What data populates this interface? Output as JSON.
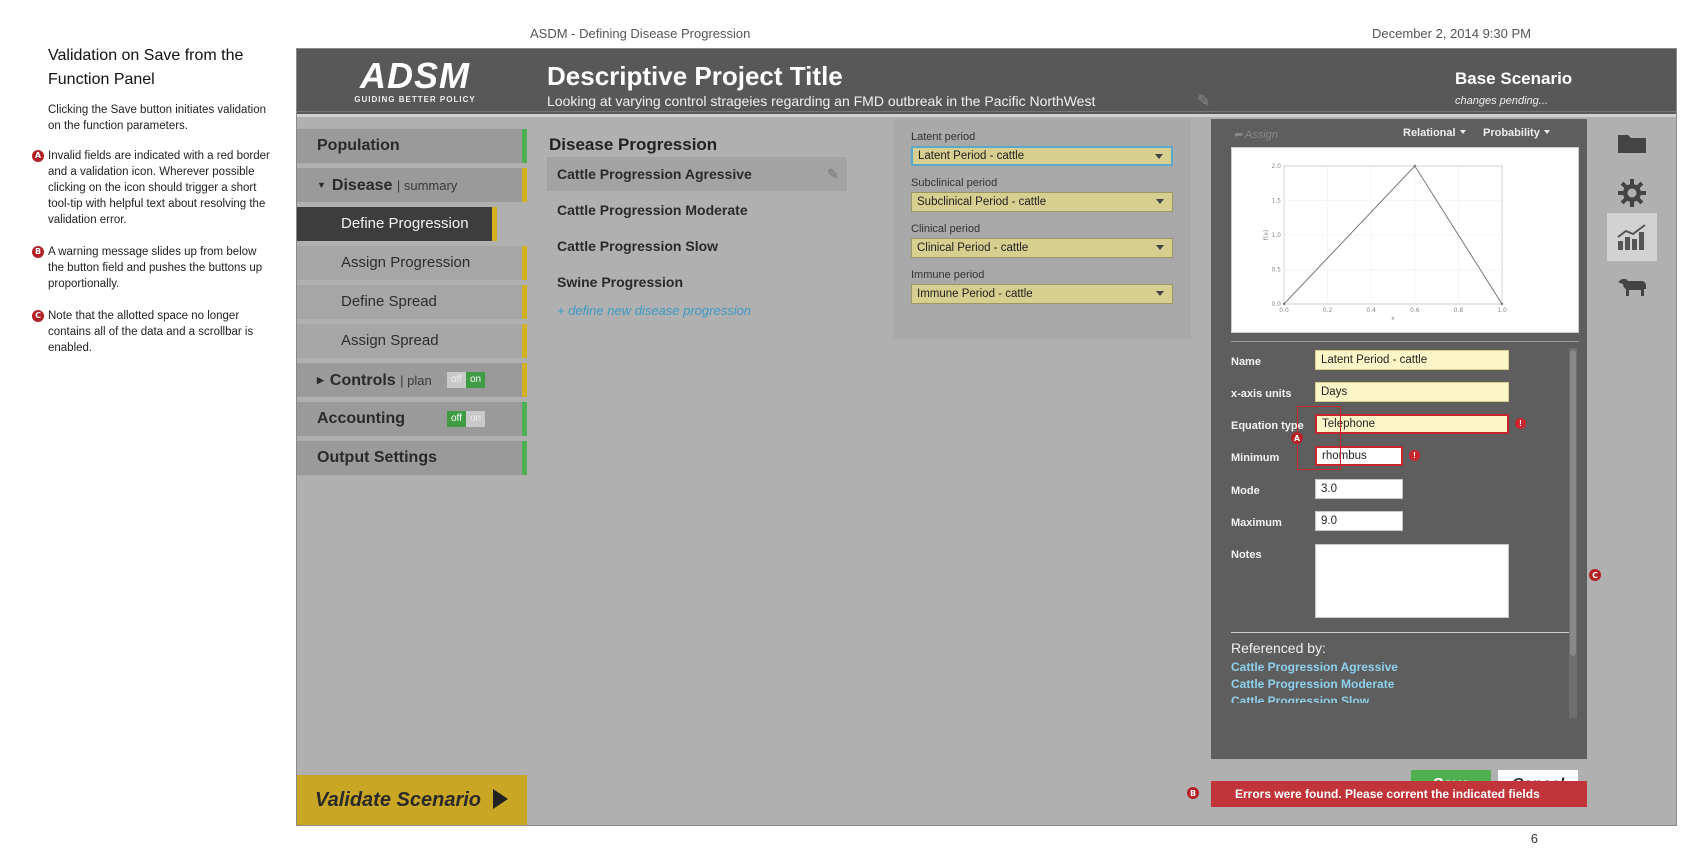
{
  "document": {
    "title": "ASDM - Defining Disease Progression",
    "date": "December 2, 2014  9:30 PM",
    "page_number": "6"
  },
  "annotations": {
    "heading": "Validation on Save from the Function Panel",
    "intro": "Clicking the Save button initiates validation on the function parameters.",
    "items": [
      {
        "badge": "A",
        "text": "Invalid fields are indicated with a red border and a validation icon. Wherever possible clicking on the icon should trigger a short tool-tip with helpful text about resolving the validation error."
      },
      {
        "badge": "B",
        "text": "A warning message slides up from below the button field and pushes the buttons up proportionally."
      },
      {
        "badge": "C",
        "text": "Note that the allotted space no longer contains all of the data and a scrollbar is enabled."
      }
    ]
  },
  "header": {
    "logo_text": "ADSM",
    "logo_tagline": "GUIDING BETTER POLICY",
    "project_title": "Descriptive Project Title",
    "project_subtitle": "Looking at varying control strageies regarding an FMD outbreak in the Pacific NorthWest",
    "scenario_name": "Base Scenario",
    "scenario_status": "changes pending..."
  },
  "nav": {
    "population": "Population",
    "disease": "Disease",
    "disease_summary": "| summary",
    "define_progression": "Define Progression",
    "assign_progression": "Assign Progression",
    "define_spread": "Define Spread",
    "assign_spread": "Assign Spread",
    "controls": "Controls",
    "controls_plan": "| plan",
    "accounting": "Accounting",
    "output_settings": "Output Settings",
    "toggle_off": "off",
    "toggle_on": "on",
    "validate": "Validate Scenario"
  },
  "disease_progression": {
    "heading": "Disease Progression",
    "items": [
      "Cattle Progression Agressive",
      "Cattle Progression Moderate",
      "Cattle Progression Slow",
      "Swine Progression"
    ],
    "new_link": "+  define new disease progression"
  },
  "periods": [
    {
      "label": "Latent period",
      "value": "Latent Period - cattle"
    },
    {
      "label": "Subclinical period",
      "value": "Subclinical Period - cattle"
    },
    {
      "label": "Clinical period",
      "value": "Clinical Period - cattle"
    },
    {
      "label": "Immune period",
      "value": "Immune Period - cattle"
    }
  ],
  "function_panel": {
    "assign_label": "Assign",
    "relational_label": "Relational",
    "probability_label": "Probability",
    "fields": {
      "name_label": "Name",
      "name_value": "Latent Period - cattle",
      "x_units_label": "x-axis units",
      "x_units_value": "Days",
      "eq_type_label": "Equation type",
      "eq_type_value": "Telephone",
      "minimum_label": "Minimum",
      "minimum_value": "rhombus",
      "mode_label": "Mode",
      "mode_value": "3.0",
      "maximum_label": "Maximum",
      "maximum_value": "9.0",
      "notes_label": "Notes"
    },
    "error_icon": "!",
    "referenced_by_label": "Referenced by:",
    "referenced_by": [
      "Cattle Progression Agressive",
      "Cattle Progression Moderate",
      "Cattle Progression Slow"
    ],
    "save_label": "Save",
    "cancel_label": "Cancel",
    "error_message": "Errors were found. Please corrent the indicated fields"
  },
  "chart_data": {
    "type": "line",
    "x": [
      0.0,
      0.6,
      1.0
    ],
    "series": [
      {
        "values": [
          0.0,
          2.0,
          0.0
        ]
      }
    ],
    "xlim": [
      0.0,
      1.0
    ],
    "ylim": [
      0.0,
      2.0
    ],
    "xticks": [
      "0.0",
      "0.2",
      "0.4",
      "0.6",
      "0.8",
      "1.0"
    ],
    "yticks": [
      "0.0",
      "0.5",
      "1.0",
      "1.5",
      "2.0"
    ],
    "ylabel": "f(x)",
    "xlabel": "x"
  },
  "rail": {
    "icons": [
      "folder-icon",
      "gear-icon",
      "chart-icon",
      "cow-icon"
    ]
  },
  "colors": {
    "accent_green": "#4fb050",
    "accent_yellow": "#d2b020",
    "error_red": "#c0343a",
    "link_blue": "#3c9ac4"
  }
}
